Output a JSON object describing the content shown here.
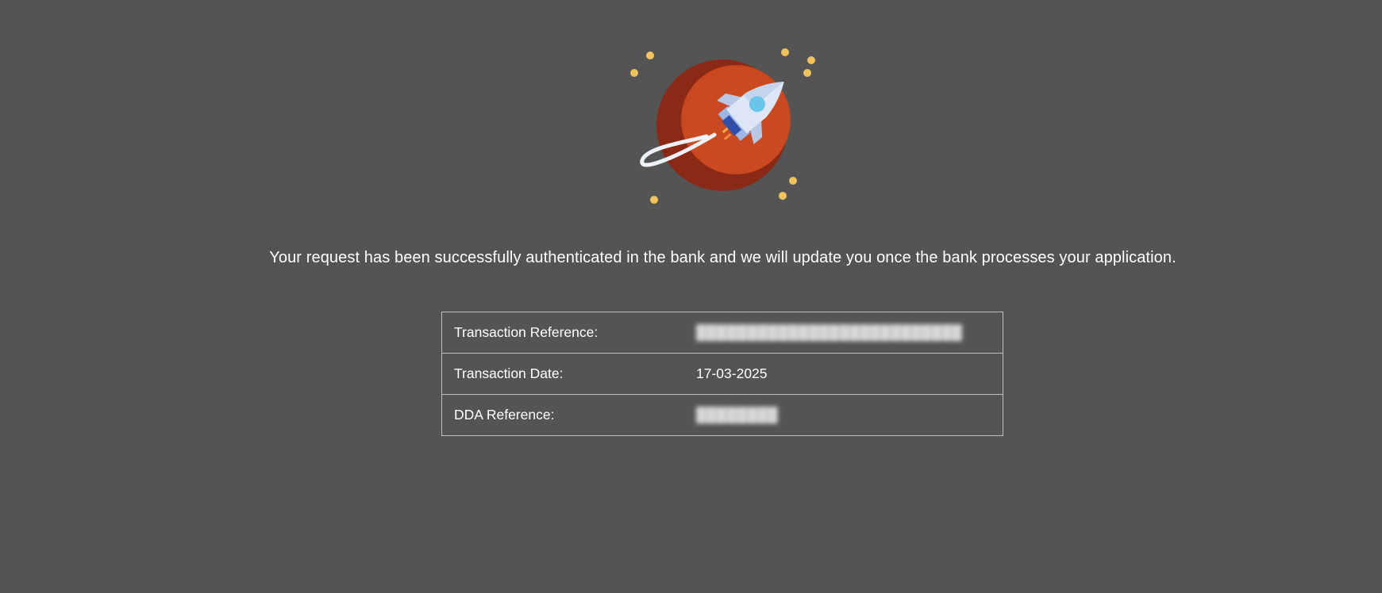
{
  "message": "Your request has been successfully authenticated in the bank and we will update you once the bank processes your application.",
  "details": {
    "rows": [
      {
        "label": "Transaction Reference:",
        "value": "",
        "redacted": true
      },
      {
        "label": "Transaction Date:",
        "value": "17-03-2025",
        "redacted": false
      },
      {
        "label": "DDA Reference:",
        "value": "",
        "redacted": true
      }
    ]
  },
  "illustration": {
    "icon": "rocket-orbiting-planet-icon",
    "planet_color": "#c8471f",
    "star_color": "#f2c35a"
  }
}
